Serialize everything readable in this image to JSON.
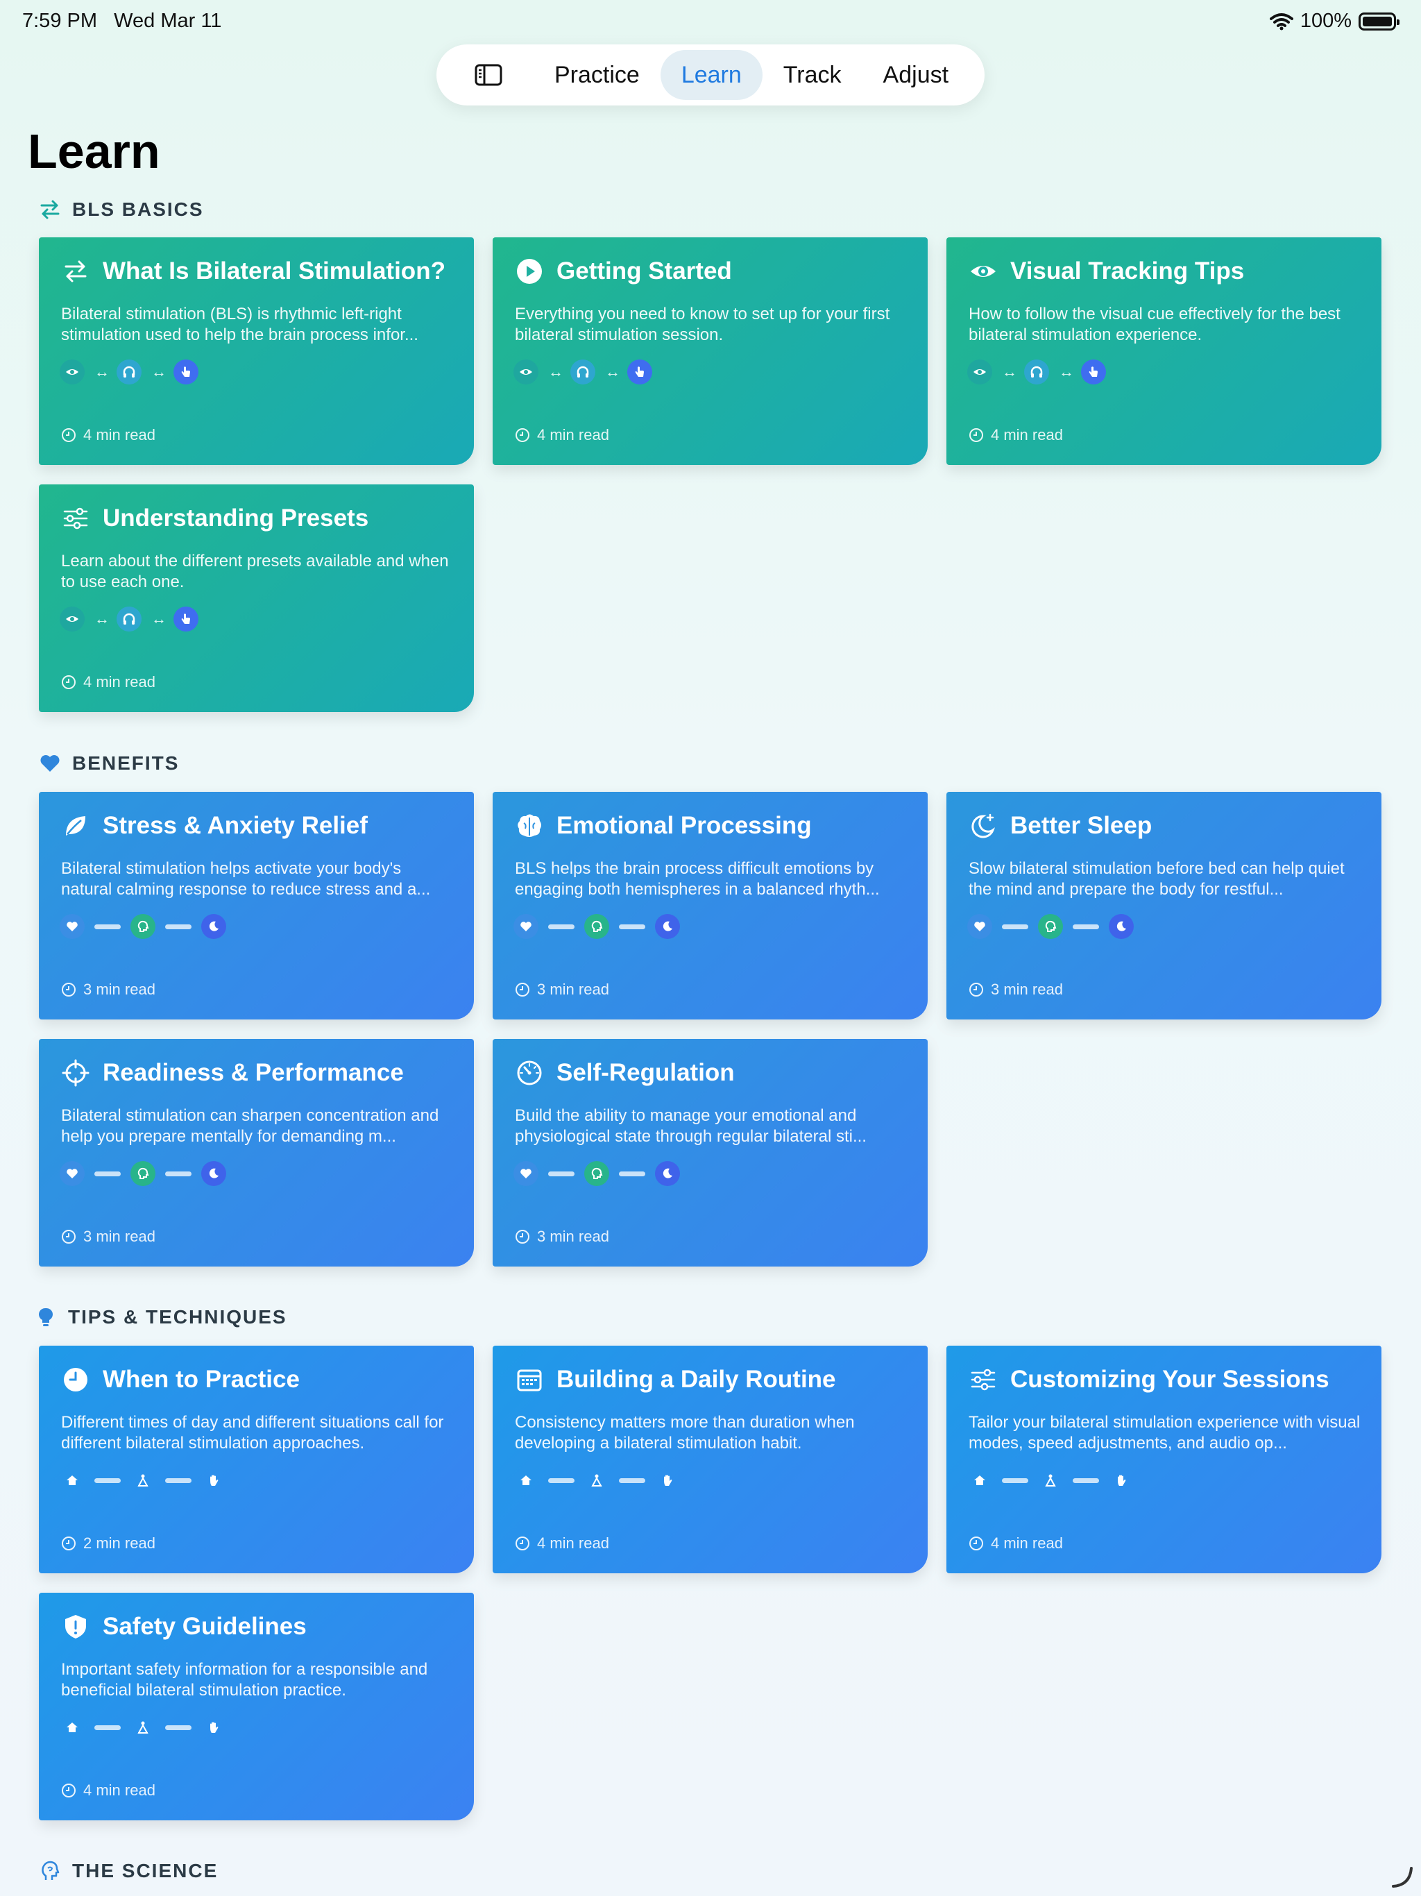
{
  "status": {
    "time": "7:59 PM",
    "date": "Wed Mar 11",
    "battery": "100%"
  },
  "nav": {
    "tabs": [
      {
        "label": "Practice"
      },
      {
        "label": "Learn"
      },
      {
        "label": "Track"
      },
      {
        "label": "Adjust"
      }
    ]
  },
  "page": {
    "title": "Learn"
  },
  "sections": {
    "basics": {
      "title": "BLS BASICS"
    },
    "benefits": {
      "title": "BENEFITS"
    },
    "tips": {
      "title": "TIPS & TECHNIQUES"
    },
    "science": {
      "title": "THE SCIENCE"
    }
  },
  "cards": {
    "bilateral": {
      "title": "What Is Bilateral Stimulation?",
      "desc": "Bilateral stimulation (BLS) is rhythmic left-right stimulation used to help the brain process infor...",
      "read": "4 min read"
    },
    "started": {
      "title": "Getting Started",
      "desc": "Everything you need to know to set up for your first bilateral stimulation session.",
      "read": "4 min read"
    },
    "visual": {
      "title": "Visual Tracking Tips",
      "desc": "How to follow the visual cue effectively for the best bilateral stimulation experience.",
      "read": "4 min read"
    },
    "presets": {
      "title": "Understanding Presets",
      "desc": "Learn about the different presets available and when to use each one.",
      "read": "4 min read"
    },
    "stress": {
      "title": "Stress & Anxiety Relief",
      "desc": "Bilateral stimulation helps activate your body's natural calming response to reduce stress and a...",
      "read": "3 min read"
    },
    "emotional": {
      "title": "Emotional Processing",
      "desc": "BLS helps the brain process difficult emotions by engaging both hemispheres in a balanced rhyth...",
      "read": "3 min read"
    },
    "sleep": {
      "title": "Better Sleep",
      "desc": "Slow bilateral stimulation before bed can help quiet the mind and prepare the body for restful...",
      "read": "3 min read"
    },
    "readiness": {
      "title": "Readiness & Performance",
      "desc": "Bilateral stimulation can sharpen concentration and help you prepare mentally for demanding m...",
      "read": "3 min read"
    },
    "selfreg": {
      "title": "Self-Regulation",
      "desc": "Build the ability to manage your emotional and physiological state through regular bilateral sti...",
      "read": "3 min read"
    },
    "when": {
      "title": "When to Practice",
      "desc": "Different times of day and different situations call for different bilateral stimulation approaches.",
      "read": "2 min read"
    },
    "routine": {
      "title": "Building a Daily Routine",
      "desc": "Consistency matters more than duration when developing a bilateral stimulation habit.",
      "read": "4 min read"
    },
    "custom": {
      "title": "Customizing Your Sessions",
      "desc": "Tailor your bilateral stimulation experience with visual modes, speed adjustments, and audio op...",
      "read": "4 min read"
    },
    "safety": {
      "title": "Safety Guidelines",
      "desc": "Important safety information for a responsible and beneficial bilateral stimulation practice.",
      "read": "4 min read"
    }
  },
  "icons": {
    "arrow_glyph": "↔"
  }
}
